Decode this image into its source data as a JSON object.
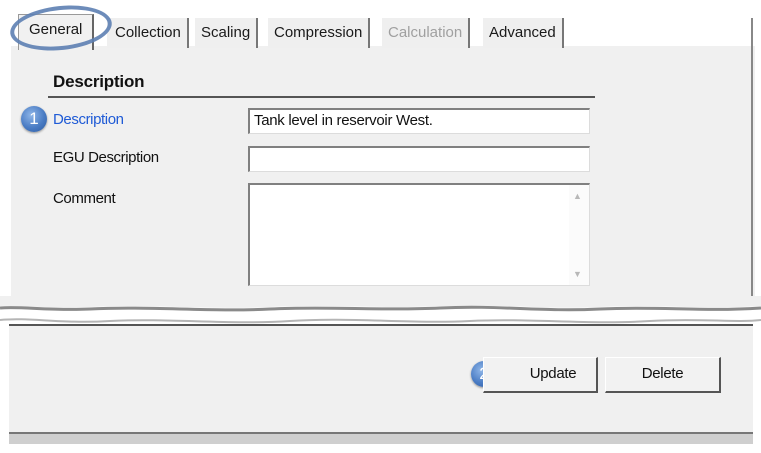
{
  "tabs": [
    {
      "label": "General",
      "state": "active"
    },
    {
      "label": "Collection",
      "state": "normal"
    },
    {
      "label": "Scaling",
      "state": "normal"
    },
    {
      "label": "Compression",
      "state": "normal"
    },
    {
      "label": "Calculation",
      "state": "disabled"
    },
    {
      "label": "Advanced",
      "state": "normal"
    }
  ],
  "section": {
    "title": "Description"
  },
  "fields": {
    "description": {
      "label": "Description",
      "value": "Tank level in reservoir West."
    },
    "egu_description": {
      "label": "EGU Description",
      "value": ""
    },
    "comment": {
      "label": "Comment",
      "value": ""
    }
  },
  "buttons": {
    "update": "Update",
    "delete": "Delete"
  },
  "callouts": {
    "one": "1",
    "two": "2"
  },
  "colors": {
    "link_label": "#1f5bd6",
    "callout": "#4a7cc4",
    "panel": "#f0f0f0"
  },
  "icons": {
    "scroll_up": "triangle-up-icon",
    "scroll_down": "triangle-down-icon"
  }
}
